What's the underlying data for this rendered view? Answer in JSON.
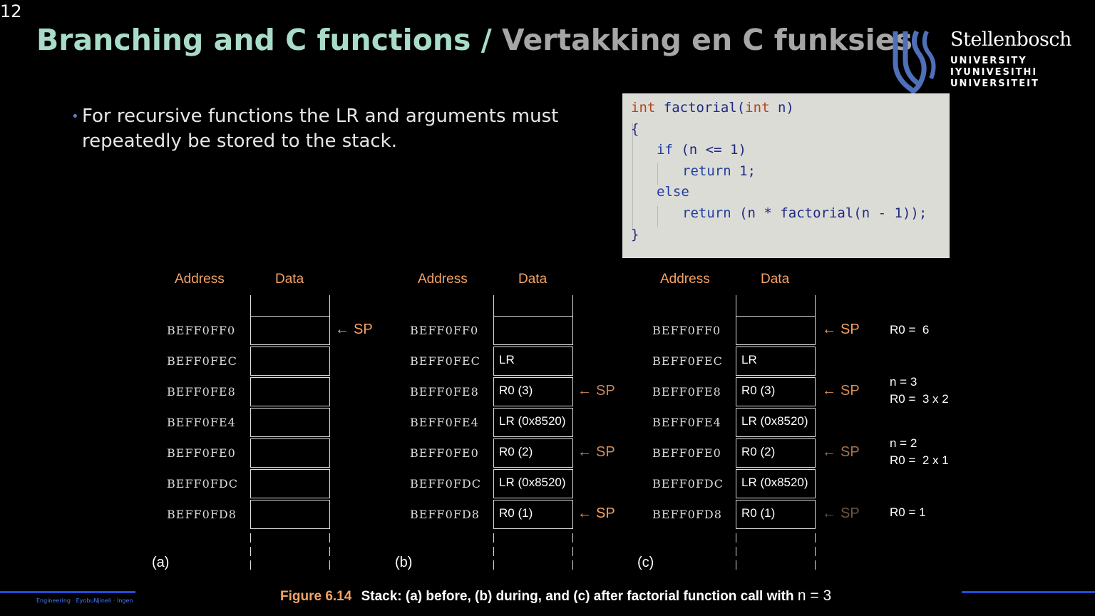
{
  "slide_number": "12",
  "title": {
    "english": "Branching and C functions /",
    "afrikaans": "Vertakking en C funksies"
  },
  "logo": {
    "name": "Stellenbosch",
    "lines": [
      "UNIVERSITY",
      "IYUNIVESITHI",
      "UNIVERSITEIT"
    ]
  },
  "bullet": {
    "text": "For recursive functions the LR and arguments must repeatedly be stored to the stack."
  },
  "code": {
    "lines": [
      "int factorial(int n)",
      "{",
      "if (n <= 1)",
      "return 1;",
      "else",
      "return (n * factorial(n - 1));",
      "}"
    ]
  },
  "figure": {
    "column_headers": {
      "address": "Address",
      "data": "Data"
    },
    "addresses": [
      "BEFF0FF0",
      "BEFF0FEC",
      "BEFF0FE8",
      "BEFF0FE4",
      "BEFF0FE0",
      "BEFF0FDC",
      "BEFF0FD8"
    ],
    "panels": [
      {
        "label": "(a)",
        "cells": [
          "",
          "",
          "",
          "",
          "",
          "",
          ""
        ]
      },
      {
        "label": "(b)",
        "cells": [
          "",
          "LR",
          "R0 (3)",
          "LR (0x8520)",
          "R0 (2)",
          "LR (0x8520)",
          "R0 (1)"
        ]
      },
      {
        "label": "(c)",
        "cells": [
          "",
          "LR",
          "R0 (3)",
          "LR (0x8520)",
          "R0 (2)",
          "LR (0x8520)",
          "R0 (1)"
        ]
      }
    ],
    "sp_label": "SP",
    "sp_arrow": "←",
    "notes_c": [
      "R0 =  6",
      "n = 3\nR0 =  3 x 2",
      "n = 2\nR0 =  2 x 1",
      "R0 = 1"
    ],
    "caption": {
      "figure_label": "Figure 6.14",
      "text": "Stack: (a) before, (b) during, and (c) after factorial function call with",
      "n_expr": "n = 3"
    }
  },
  "footer": {
    "text": "Engineering · EyobuNjineli · Ingen"
  },
  "colors": {
    "title_english": "#a8dcc8",
    "title_afrikaans": "#a6a6a6",
    "accent_orange": "#f5a263",
    "footer_blue": "#1f4fd8"
  }
}
